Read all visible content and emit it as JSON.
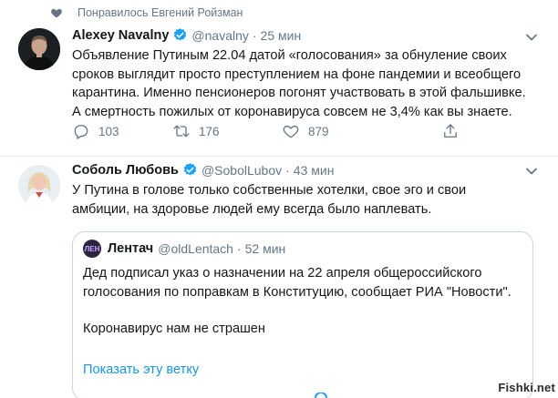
{
  "social_context": {
    "text": "Понравилось Евгений Ройзман",
    "icon": "heart-icon"
  },
  "tweets": [
    {
      "name": "Alexey Navalny",
      "verified": true,
      "handle": "@navalny",
      "dot": "·",
      "time": "25 мин",
      "lines": [
        "Объявление Путиным 22.04 датой «голосования» за обнуление своих",
        "сроков выглядит просто преступлением на фоне пандемии и всеобщего",
        "карантина. Именно пенсионеров погонят участвовать в этой фальшивке.",
        "А смертность пожилых от коронавируса совсем не 3,4% как вы знаете."
      ],
      "actions": {
        "replies": "103",
        "retweets": "176",
        "likes": "879"
      }
    },
    {
      "name": "Соболь Любовь",
      "verified": true,
      "handle": "@SobolLubov",
      "dot": "·",
      "time": "43 мин",
      "lines": [
        "У Путина в голове только собственные хотелки, свое эго и свои",
        "амбиции, на здоровье людей ему всегда было наплевать."
      ],
      "quote": {
        "avatar_text": "ЛЕН",
        "name": "Лентач",
        "handle": "@oldLentach",
        "dot": "·",
        "time": "52 мин",
        "lines": [
          "Дед подписал указ о назначении на 22 апреля общероссийского",
          "голосования по поправкам в Конституцию, сообщает РИА \"Новости\".",
          "Коронавирус нам не страшен"
        ],
        "show_thread": "Показать эту ветку"
      }
    }
  ],
  "watermark": "Fishki.net",
  "colors": {
    "accent": "#1b95e0",
    "muted": "#657786",
    "text": "#14171a",
    "border": "#ccd6dd"
  }
}
